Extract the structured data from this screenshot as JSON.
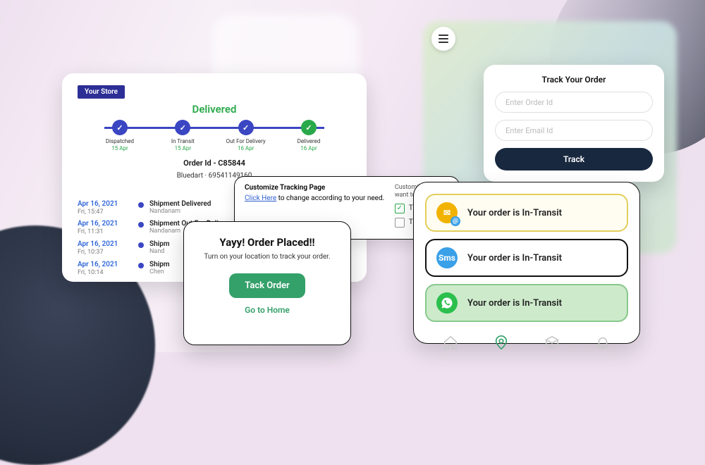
{
  "track_form": {
    "title": "Track Your Order",
    "order_placeholder": "Enter Order Id",
    "email_placeholder": "Enter Email Id",
    "button": "Track"
  },
  "main": {
    "store_label": "Your Store",
    "status": "Delivered",
    "steps": [
      {
        "label": "Dispatched",
        "date": "15 Apr"
      },
      {
        "label": "In Transit",
        "date": "15 Apr"
      },
      {
        "label": "Out For Delivery",
        "date": "16 Apr"
      },
      {
        "label": "Delivered",
        "date": "16 Apr"
      }
    ],
    "order_id_label": "Order Id - C85844",
    "carrier": "Bluedart · 69541149160",
    "events": [
      {
        "date": "Apr 16, 2021",
        "time": "Fri, 15:47",
        "title": "Shipment Delivered",
        "loc": "Nandanam"
      },
      {
        "date": "Apr 16, 2021",
        "time": "Fri, 11:31",
        "title": "Shipment Out For Deli",
        "loc": "Nandanam"
      },
      {
        "date": "Apr 16, 2021",
        "time": "Fri, 10:37",
        "title": "Shipm",
        "loc": "Nand"
      },
      {
        "date": "Apr 16, 2021",
        "time": "Fri, 10:14",
        "title": "Shipm",
        "loc": "Chen"
      }
    ]
  },
  "customize": {
    "title": "Customize Tracking Page",
    "link_text": "Click Here",
    "link_rest": " to change according to your need.",
    "right_title": "Customize tracking",
    "right_sub": "want to hide )",
    "opt1": "Tracking n",
    "opt2": "Tracking se"
  },
  "placed": {
    "title": "Yayy! Order Placed!!",
    "subtitle": "Turn on your location to track your order.",
    "primary": "Tack Order",
    "secondary": "Go to Home"
  },
  "notifications": {
    "items": [
      {
        "text": "Your order is In-Transit"
      },
      {
        "text": "Your order is In-Transit"
      },
      {
        "text": "Your order is In-Transit"
      }
    ]
  }
}
